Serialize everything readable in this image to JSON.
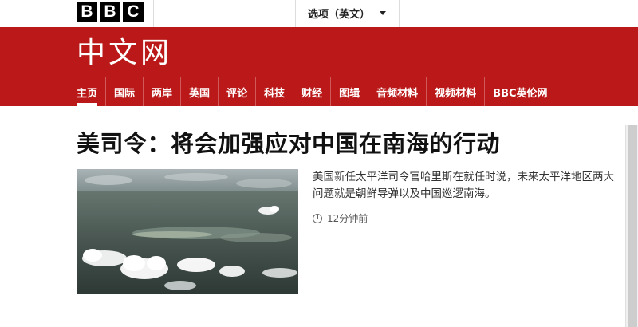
{
  "brand": {
    "logo_letters": [
      "B",
      "B",
      "C"
    ],
    "site_title": "中文网"
  },
  "language_selector": {
    "label": "选项（英文）"
  },
  "nav": {
    "items": [
      {
        "label": "主页",
        "active": true
      },
      {
        "label": "国际"
      },
      {
        "label": "两岸"
      },
      {
        "label": "英国"
      },
      {
        "label": "评论"
      },
      {
        "label": "科技"
      },
      {
        "label": "财经"
      },
      {
        "label": "图辑"
      },
      {
        "label": "音频材料"
      },
      {
        "label": "视频材料"
      },
      {
        "label": "BBC英伦网"
      }
    ]
  },
  "article": {
    "headline": "美司令：将会加强应对中国在南海的行动",
    "summary": "美国新任太平洋司令官哈里斯在就任时说，未来太平洋地区两大问题就是朝鲜导弹以及中国巡逻南海。",
    "time_ago": "12分钟前"
  },
  "colors": {
    "brand_red": "#bb1919"
  }
}
